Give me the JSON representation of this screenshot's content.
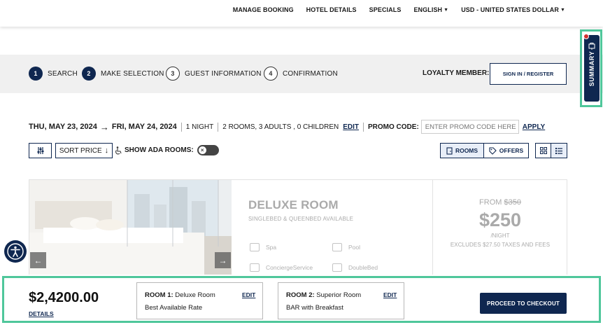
{
  "topnav": {
    "manage_booking": "MANAGE BOOKING",
    "hotel_details": "HOTEL DETAILS",
    "specials": "SPECIALS",
    "language": "ENGLISH",
    "currency": "USD - UNITED STATES DOLLAR"
  },
  "steps": [
    {
      "num": "1",
      "label": "SEARCH",
      "state": "done"
    },
    {
      "num": "2",
      "label": "MAKE SELECTION",
      "state": "current"
    },
    {
      "num": "3",
      "label": "GUEST INFORMATION",
      "state": "todo"
    },
    {
      "num": "4",
      "label": "CONFIRMATION",
      "state": "todo"
    }
  ],
  "loyalty": {
    "label": "LOYALTY MEMBER:",
    "button": "SIGN IN / REGISTER"
  },
  "summary_tab": {
    "label": "SUMMARY"
  },
  "search": {
    "checkin": "THU, MAY 23, 2024",
    "arrow": "→",
    "checkout": "FRI, MAY 24, 2024",
    "nights": "1 NIGHT",
    "guests": "2 ROOMS, 3 ADULTS , 0 CHILDREN",
    "edit": "EDIT",
    "promo_label": "PROMO CODE:",
    "promo_placeholder": "ENTER PROMO CODE HERE",
    "apply": "APPLY"
  },
  "filters": {
    "sort_label": "SORT PRICE",
    "ada_label": "SHOW ADA ROOMS:",
    "ada_enabled": false,
    "rooms_tab": "ROOMS",
    "offers_tab": "OFFERS"
  },
  "room_card": {
    "title": "DELUXE ROOM",
    "subtitle": "SINGLEBED & QUEENBED AVAILABLE",
    "amenities": [
      "Spa",
      "Pool",
      "ConciergeService",
      "DoubleBed"
    ],
    "from_label": "FROM",
    "original_price": "$350",
    "price": "$250",
    "per_night": "/NIGHT",
    "excludes": "EXCLUDES $27.50 TAXES AND FEES"
  },
  "cart": {
    "total": "$2,4200.00",
    "details": "DETAILS",
    "rooms": [
      {
        "label": "ROOM 1:",
        "name": " Deluxe Room",
        "rate": "Best Available Rate",
        "edit": "EDIT"
      },
      {
        "label": "ROOM 2:",
        "name": " Superior Room",
        "rate": "BAR with Breakfast",
        "edit": "EDIT"
      }
    ],
    "checkout_button": "PROCEED TO CHECKOUT"
  },
  "colors": {
    "navy": "#0f2750",
    "highlight": "#4fc79b",
    "steps_bg": "#f0f0f0",
    "notification": "#d32f2f"
  }
}
